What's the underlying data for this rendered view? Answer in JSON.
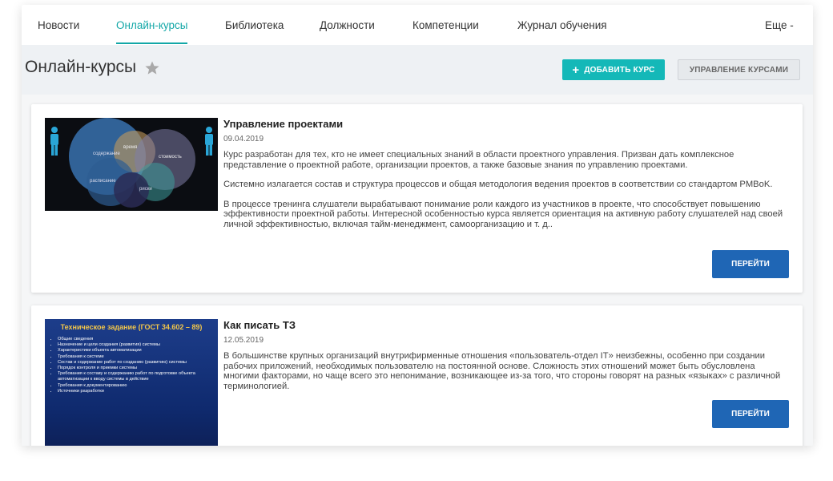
{
  "nav": {
    "items": [
      {
        "label": "Новости"
      },
      {
        "label": "Онлайн-курсы"
      },
      {
        "label": "Библиотека"
      },
      {
        "label": "Должности"
      },
      {
        "label": "Компетенции"
      },
      {
        "label": "Журнал обучения"
      }
    ],
    "more_label": "Еще -"
  },
  "header": {
    "title": "Онлайн-курсы",
    "add_button": "ДОБАВИТЬ КУРС",
    "manage_button": "УПРАВЛЕНИЕ КУРСАМИ"
  },
  "courses": [
    {
      "title": "Управление проектами",
      "date": "09.04.2019",
      "paragraphs": [
        "Курс разработан для тех, кто не имеет специальных знаний в области проектного управления. Призван дать комплексное представление о проектной работе, организации проектов, а также базовые знания по управлению проектами.",
        "Системно излагается состав и структура процессов и общая методология ведения проектов в соответствии со стандартом PMBoK.",
        "В процессе тренинга слушатели вырабатывают понимание роли каждого из участников в проекте, что способствует повышению эффективности проектной работы. Интересной особенностью курса является ориентация на активную работу слушателей над своей личной эффективностью, включая тайм-менеджмент, самоорганизацию и т. д.."
      ],
      "button": "ПЕРЕЙТИ",
      "thumb_labels": [
        "содержание",
        "время",
        "стоимость",
        "расписание",
        "риски"
      ]
    },
    {
      "title": "Как писать ТЗ",
      "date": "12.05.2019",
      "paragraphs": [
        "В большинстве крупных организаций внутрифирменные отношения «пользователь-отдел IT» неизбежны, особенно при создании рабочих приложений, необходимых пользователю на постоянной основе. Сложность этих отношений может быть обусловлена многими факторами, но чаще всего это непонимание, возникающее из-за того, что стороны говорят на разных «языках» с различной терминологией."
      ],
      "button": "ПЕРЕЙТИ",
      "slide": {
        "title": "Техническое задание (ГОСТ 34.602 – 89)",
        "items": [
          "Общие сведения",
          "Назначение и цели создания (развития) системы",
          "Характеристики объекта автоматизации",
          "Требования к системе",
          "Состав и содержание работ по созданию (развитию) системы",
          "Порядок контроля и приемки системы",
          "Требования к составу и содержанию работ по подготовке объекта автоматизации к вводу системы в действие",
          "Требования к документированию",
          "Источники разработки"
        ]
      }
    }
  ],
  "colors": {
    "accent": "#13a7a7",
    "add_button": "#14b8b8",
    "go_button": "#1f66b5"
  }
}
